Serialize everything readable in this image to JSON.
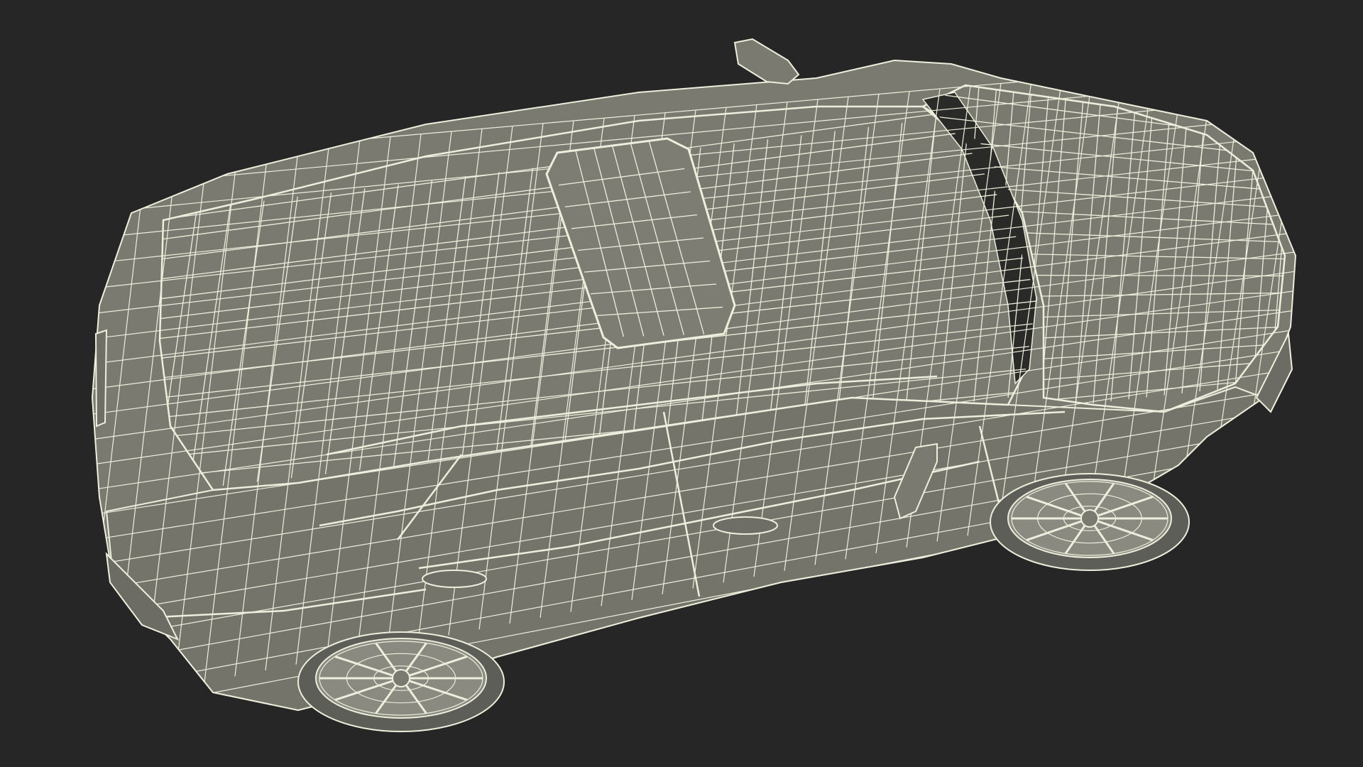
{
  "viewport": {
    "background_color": "#262626"
  },
  "model": {
    "subject": "car-wireframe",
    "surface_color": "#7a7a70",
    "surface_shadow_color": "#5e5e56",
    "wire_color": "#eeeedd",
    "tire_color": "#5a5a54",
    "rim_color": "#8a8a80"
  }
}
